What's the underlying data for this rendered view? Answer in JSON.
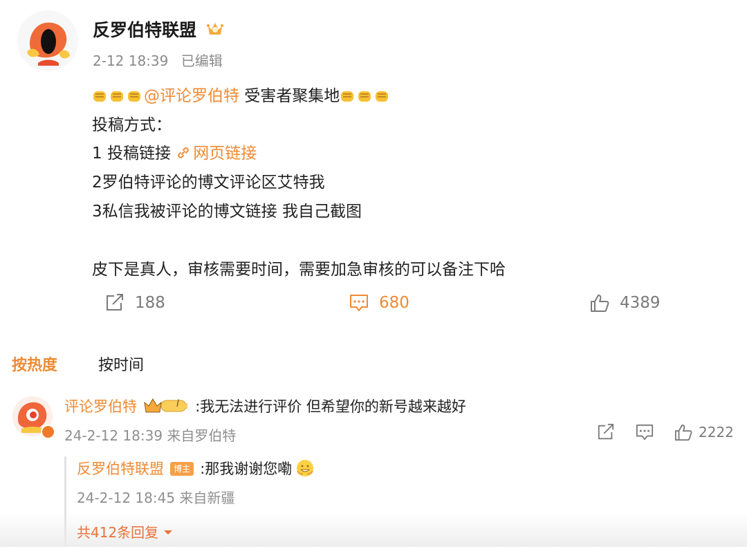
{
  "post": {
    "author": "反罗伯特联盟",
    "time": "2-12 18:39",
    "edited": "已编辑",
    "mention": "@评论罗伯特",
    "line1_suffix": " 受害者聚集地",
    "line2": "投稿方式：",
    "line3_prefix": "1 投稿链接 ",
    "line3_link": "网页链接",
    "line4": "2罗伯特评论的博文评论区艾特我",
    "line5": "3私信我被评论的博文链接 我自己截图",
    "line6": "皮下是真人，审核需要时间，需要加急审核的可以备注下哈",
    "repost_count": "188",
    "comment_count": "680",
    "like_count": "4389"
  },
  "tabs": {
    "hot": "按热度",
    "time": "按时间"
  },
  "comment": {
    "author": "评论罗伯特",
    "level": "I",
    "text": ":我无法进行评价 但希望你的新号越来越好",
    "meta": "24-2-12 18:39 来自罗伯特",
    "like_count": "2222"
  },
  "reply": {
    "author": "反罗伯特联盟",
    "host_badge": "博主",
    "text": ":那我谢谢您嘞",
    "meta": "24-2-12 18:45 来自新疆",
    "total": "共412条回复"
  },
  "colors": {
    "accent": "#f08a32",
    "text": "#222222",
    "muted": "#8a8a8a"
  },
  "icons": [
    "repost-icon",
    "comment-icon",
    "like-icon",
    "fist-emoji-icon",
    "link-icon",
    "crown-level-badge-icon",
    "grin-emoji-icon",
    "chevron-down-icon"
  ]
}
